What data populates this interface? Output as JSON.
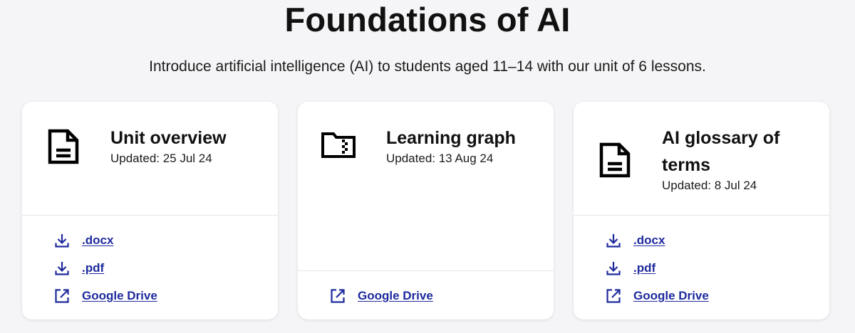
{
  "page": {
    "title": "Foundations of AI",
    "intro": "Introduce artificial intelligence (AI) to students aged 11–14 with our unit of 6 lessons."
  },
  "colors": {
    "background": "#f5f5f7",
    "card": "#ffffff",
    "link": "#1e2a9c",
    "text": "#111111"
  },
  "cards": [
    {
      "icon": "document-icon",
      "title": "Unit overview",
      "updated": "Updated: 25 Jul 24",
      "links": [
        {
          "icon": "download-icon",
          "label": ".docx"
        },
        {
          "icon": "download-icon",
          "label": ".pdf"
        },
        {
          "icon": "external-link-icon",
          "label": "Google Drive"
        }
      ]
    },
    {
      "icon": "folder-zip-icon",
      "title": "Learning graph",
      "updated": "Updated: 13 Aug 24",
      "links": [
        {
          "icon": "external-link-icon",
          "label": "Google Drive"
        }
      ]
    },
    {
      "icon": "document-icon",
      "title": "AI glossary of terms",
      "updated": "Updated: 8 Jul 24",
      "links": [
        {
          "icon": "download-icon",
          "label": ".docx"
        },
        {
          "icon": "download-icon",
          "label": ".pdf"
        },
        {
          "icon": "external-link-icon",
          "label": "Google Drive"
        }
      ]
    }
  ]
}
